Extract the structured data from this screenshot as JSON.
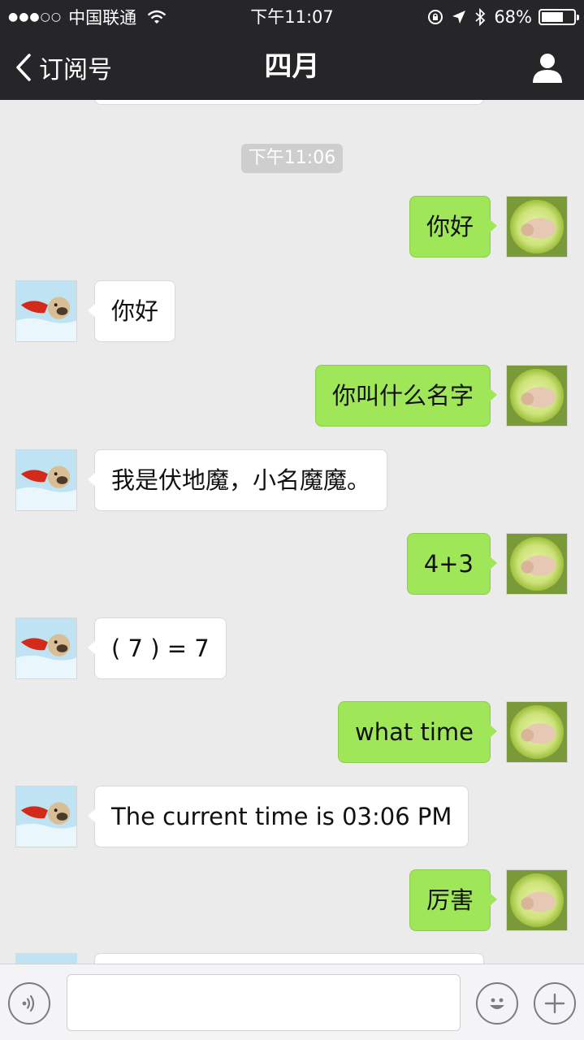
{
  "status_bar": {
    "signal_dots": "●●●○○",
    "carrier": "中国联通",
    "time": "下午11:07",
    "battery_percent": "68%",
    "battery_level": 0.68,
    "icons": [
      "wifi-icon",
      "rotation-lock-icon",
      "location-arrow-icon",
      "bluetooth-icon",
      "battery-icon"
    ]
  },
  "nav": {
    "back_label": "订阅号",
    "title": "四月",
    "right_icon": "person-icon"
  },
  "chat": {
    "timestamp": "下午11:06",
    "messages": [
      {
        "side": "out",
        "text": "你好"
      },
      {
        "side": "in",
        "text": "你好"
      },
      {
        "side": "out",
        "text": "你叫什么名字"
      },
      {
        "side": "in",
        "text": "我是伏地魔，小名魔魔。"
      },
      {
        "side": "out",
        "text": "4+3"
      },
      {
        "side": "in",
        "text": "( 7 ) = 7"
      },
      {
        "side": "out",
        "text": "what time"
      },
      {
        "side": "in",
        "text": "The current time is 03:06 PM"
      },
      {
        "side": "out",
        "text": "厉害"
      }
    ]
  },
  "input_bar": {
    "value": "",
    "icons": [
      "voice-icon",
      "emoji-icon",
      "plus-icon"
    ]
  },
  "colors": {
    "bar_bg": "#262629",
    "chat_bg": "#ebebeb",
    "outgoing_bubble": "#9fe658",
    "incoming_bubble": "#ffffff",
    "timestamp_bg": "#cecece"
  }
}
